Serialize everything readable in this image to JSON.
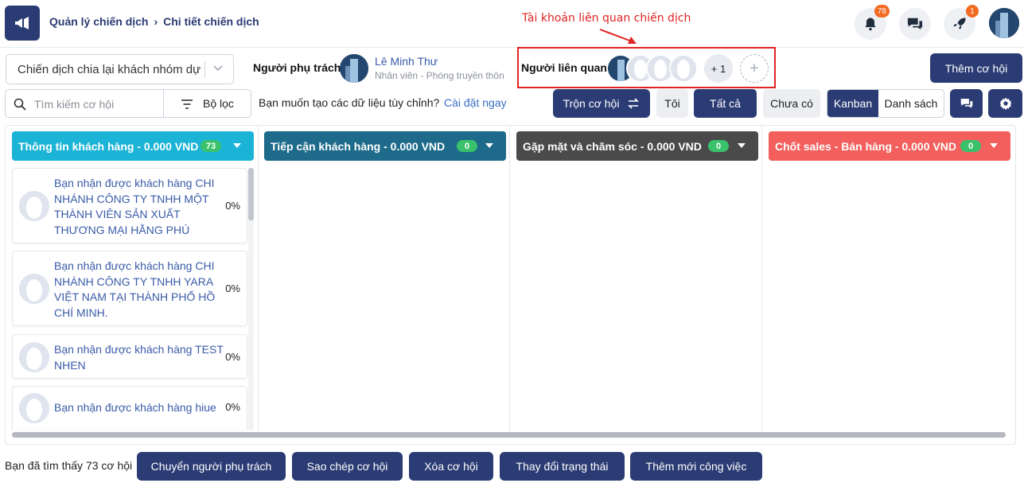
{
  "breadcrumb": {
    "parent": "Quản lý chiến dịch",
    "current": "Chi tiết chiến dịch"
  },
  "annotation": {
    "text": "Tài khoản liên quan chiến dịch",
    "color": "#e02424"
  },
  "header": {
    "notifications_count": "78",
    "rocket_count": "1"
  },
  "campaign_select": {
    "value": "Chiến dịch chia lại khách nhóm dự p"
  },
  "owner": {
    "label": "Người phụ trách",
    "name": "Lê Minh Thư",
    "role": "Nhân viên - Phòng truyền thôn"
  },
  "related": {
    "label": "Người liên quan",
    "more": "+ 1"
  },
  "add_opportunity": "Thêm cơ hội",
  "search": {
    "placeholder": "Tìm kiếm cơ hội",
    "filter_label": "Bộ lọc"
  },
  "custom_data": {
    "question": "Bạn muốn tạo các dữ liệu tùy chỉnh?",
    "link": "Cài đặt ngay"
  },
  "toolbar": {
    "merge": "Trộn cơ hội",
    "mine": "Tôi",
    "all": "Tất cả",
    "none": "Chưa có",
    "kanban": "Kanban",
    "list": "Danh sách"
  },
  "columns": [
    {
      "title": "Thông tin khách hàng - 0.000 VND",
      "count": "73",
      "color": "#1bb3d6"
    },
    {
      "title": "Tiếp cận khách hàng - 0.000 VND",
      "count": "0",
      "color": "#1d6a8a"
    },
    {
      "title": "Gặp mặt và chăm sóc - 0.000 VND",
      "count": "0",
      "color": "#4a4a4a"
    },
    {
      "title": "Chốt sales - Bán hàng - 0.000 VND",
      "count": "0",
      "color": "#f25f5c"
    }
  ],
  "cards": [
    {
      "text": "Bạn nhận được khách hàng CHI NHÁNH CÔNG TY TNHH MỘT THÀNH VIÊN SẢN XUẤT THƯƠNG MẠI HẰNG PHÚ",
      "progress": "0%"
    },
    {
      "text": "Bạn nhận được khách hàng CHI NHÁNH CÔNG TY TNHH YARA VIỆT NAM TẠI THÀNH PHỐ HỒ CHÍ MINH.",
      "progress": "0%"
    },
    {
      "text": "Bạn nhận được khách hàng TEST NHEN",
      "progress": "0%"
    },
    {
      "text": "Bạn nhận được khách hàng hiue",
      "progress": "0%"
    }
  ],
  "footer": {
    "found": "Bạn đã tìm thấy 73 cơ hội",
    "buttons": [
      "Chuyển người phụ trách",
      "Sao chép cơ hội",
      "Xóa cơ hội",
      "Thay đổi trạng thái",
      "Thêm mới công việc"
    ]
  }
}
